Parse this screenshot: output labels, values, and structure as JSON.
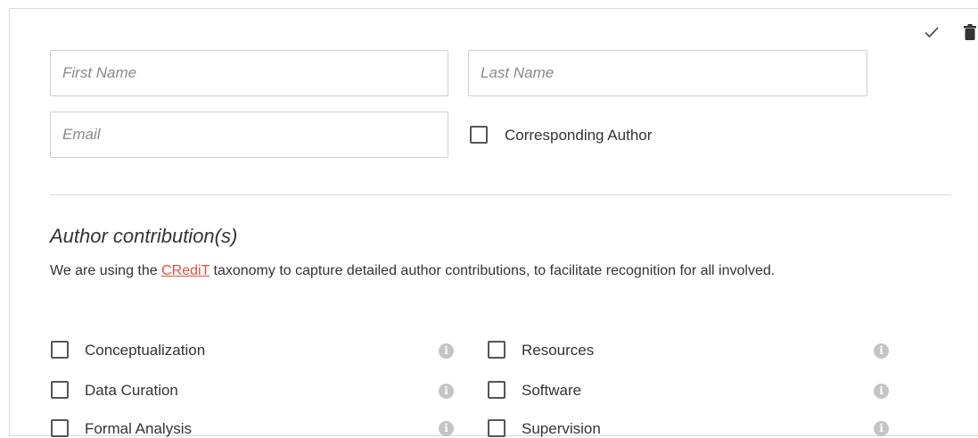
{
  "form": {
    "first_name_placeholder": "First Name",
    "last_name_placeholder": "Last Name",
    "email_placeholder": "Email",
    "corresponding_author_label": "Corresponding Author"
  },
  "actions": {
    "confirm_icon": "check-icon",
    "delete_icon": "trash-icon"
  },
  "contributions": {
    "title": "Author contribution(s)",
    "desc_before": "We are using the ",
    "link_text": "CRediT",
    "desc_after": " taxonomy to capture detailed author contributions, to facilitate recognition for all involved.",
    "roles_left": [
      "Conceptualization",
      "Data Curation",
      "Formal Analysis"
    ],
    "roles_right": [
      "Resources",
      "Software",
      "Supervision"
    ],
    "info_icon": "info-icon"
  },
  "colors": {
    "link": "#e0533c",
    "info_icon": "#c4c4c4",
    "border": "#cfcfcf"
  }
}
